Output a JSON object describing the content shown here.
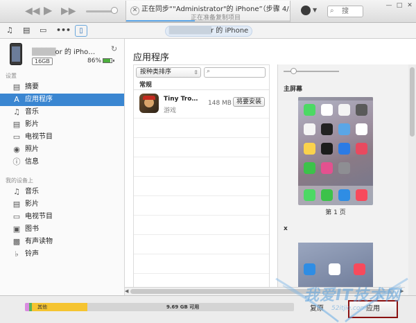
{
  "titlebar": {
    "lcd_title": "正在同步“\"Administrator\"的 iPhone”（步骤 4/…",
    "lcd_subtitle": "正在准备复制项目",
    "sync_progress": 0.42,
    "search_placeholder": "搜"
  },
  "toolbar": {
    "device_name_suffix": "r 的 iPhone"
  },
  "device": {
    "name_suffix": "or 的 iPho…",
    "capacity": "16GB",
    "battery_percent": "86%",
    "battery_level": 0.86
  },
  "sidebar": {
    "settings_header": "设置",
    "settings_items": [
      {
        "label": "摘要",
        "icon": "summary-icon"
      },
      {
        "label": "应用程序",
        "icon": "apps-icon"
      },
      {
        "label": "音乐",
        "icon": "music-icon"
      },
      {
        "label": "影片",
        "icon": "film-icon"
      },
      {
        "label": "电视节目",
        "icon": "tv-icon"
      },
      {
        "label": "照片",
        "icon": "camera-icon"
      },
      {
        "label": "信息",
        "icon": "info-icon"
      }
    ],
    "on_device_header": "我的设备上",
    "on_device_items": [
      {
        "label": "音乐",
        "icon": "music-icon"
      },
      {
        "label": "影片",
        "icon": "film-icon"
      },
      {
        "label": "电视节目",
        "icon": "tv-icon"
      },
      {
        "label": "图书",
        "icon": "book-icon"
      },
      {
        "label": "有声读物",
        "icon": "audiobook-icon"
      },
      {
        "label": "铃声",
        "icon": "bell-icon"
      }
    ]
  },
  "main": {
    "title": "应用程序",
    "sort_label": "按种类排序",
    "category_header": "常规",
    "app": {
      "name": "Tiny Tro…",
      "category": "游戏",
      "size": "148 MB",
      "action": "将要安装"
    },
    "home_screen_label": "主屏幕",
    "page_label": "第 1 页",
    "second_section_label": "x"
  },
  "bottombar": {
    "other_label": "其他",
    "free_label": "9.69 GB 可用",
    "revert_label": "复原",
    "apply_label": "应用"
  },
  "watermark": {
    "text": "我爱IT技术网",
    "url": "52itjie.com"
  },
  "colors": {
    "selection": "#3a86d1",
    "storage_apps": "#f5c431",
    "storage_other": "#d98ce0",
    "storage_free": "#d4d4d4",
    "apply_border": "#8a1010"
  }
}
